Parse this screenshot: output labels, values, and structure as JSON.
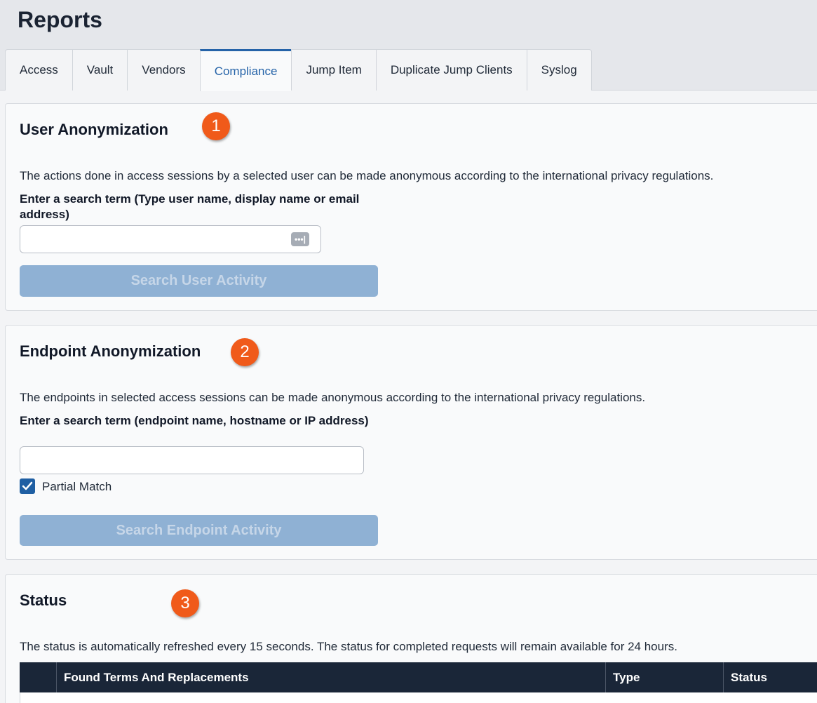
{
  "page": {
    "title": "Reports"
  },
  "tabs": [
    {
      "label": "Access",
      "active": false
    },
    {
      "label": "Vault",
      "active": false
    },
    {
      "label": "Vendors",
      "active": false
    },
    {
      "label": "Compliance",
      "active": true
    },
    {
      "label": "Jump Item",
      "active": false
    },
    {
      "label": "Duplicate Jump Clients",
      "active": false
    },
    {
      "label": "Syslog",
      "active": false
    }
  ],
  "user_anonymization": {
    "title": "User Anonymization",
    "badge": "1",
    "description": "The actions done in access sessions by a selected user can be made anonymous according to the international privacy regulations.",
    "search_label": "Enter a search term (Type user name, display name or email address)",
    "search_value": "",
    "search_icon": "password-manager-dots-icon",
    "button_label": "Search User Activity"
  },
  "endpoint_anonymization": {
    "title": "Endpoint Anonymization",
    "badge": "2",
    "description": "The endpoints in selected access sessions can be made anonymous according to the international privacy regulations.",
    "search_label": "Enter a search term (endpoint name, hostname or IP address)",
    "search_value": "",
    "partial_match_label": "Partial Match",
    "partial_match_checked": true,
    "button_label": "Search Endpoint Activity"
  },
  "status": {
    "title": "Status",
    "badge": "3",
    "description": "The status is automatically refreshed every 15 seconds. The status for completed requests will remain available for 24 hours.",
    "columns": [
      "",
      "Found Terms And Replacements",
      "Type",
      "Status"
    ]
  },
  "colors": {
    "accent": "#2563a8",
    "badge": "#f05a1a",
    "button_disabled": "#8fb1d4",
    "table_header": "#1a2638"
  }
}
